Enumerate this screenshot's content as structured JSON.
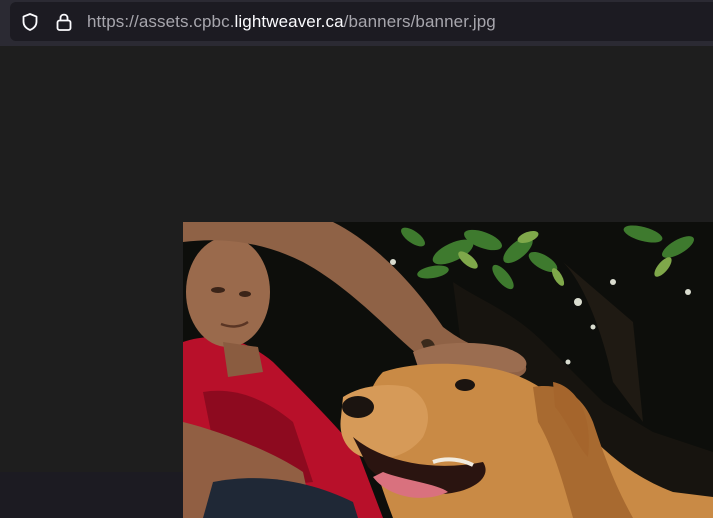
{
  "browser": {
    "address_bar": {
      "url_prefix": "https://assets.cpbc.",
      "url_host": "lightweaver.ca",
      "url_path": "/banners/banner.jpg",
      "security_icon": "shield-icon",
      "lock_icon": "lock-icon"
    }
  },
  "viewer": {
    "background_color": "#1e1e1e",
    "image": {
      "subject": "man-petting-golden-retriever",
      "accent_colors": {
        "shirt": "#b8102a",
        "dog_fur": "#c98a45",
        "foliage": "#3e7a2e",
        "skin": "#9a6a4c"
      }
    }
  },
  "colors": {
    "toolbar": "#2b2a33",
    "urlbar": "#1c1b22",
    "url_dim": "#a7a6ad",
    "url_host": "#fbfbfe"
  }
}
